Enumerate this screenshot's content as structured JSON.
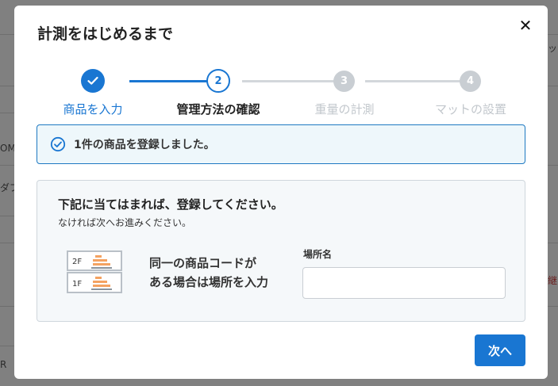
{
  "background": {
    "fragments": [
      {
        "text": "ッ",
        "kind": "right"
      },
      {
        "text": "OM",
        "kind": "left"
      },
      {
        "text": "ダブ",
        "kind": "left"
      },
      {
        "text": "継",
        "kind": "right-red"
      },
      {
        "text": "R",
        "kind": "left"
      }
    ]
  },
  "modal": {
    "title": "計測をはじめるまで",
    "close_icon": "close-icon"
  },
  "stepper": {
    "steps": [
      {
        "number": "✓",
        "label": "商品を入力",
        "state": "done"
      },
      {
        "number": "2",
        "label": "管理方法の確認",
        "state": "active"
      },
      {
        "number": "3",
        "label": "重量の計測",
        "state": "todo"
      },
      {
        "number": "4",
        "label": "マットの設置",
        "state": "todo"
      }
    ]
  },
  "alert": {
    "icon": "check-circle-icon",
    "text": "1件の商品を登録しました。"
  },
  "panel": {
    "title": "下記に当てはまれば、登録してください。",
    "subtitle": "なければ次へお進みください。",
    "shelf_labels": [
      "2F",
      "1F"
    ],
    "feature_line1": "同一の商品コードが",
    "feature_line2": "ある場合は場所を入力",
    "field_label": "場所名",
    "field_value": "",
    "field_placeholder": ""
  },
  "actions": {
    "next_label": "次へ"
  },
  "colors": {
    "primary": "#1976d2",
    "alert_bg": "#eef7fb",
    "panel_bg": "#f5f8fa",
    "step_todo": "#c9ced3"
  }
}
